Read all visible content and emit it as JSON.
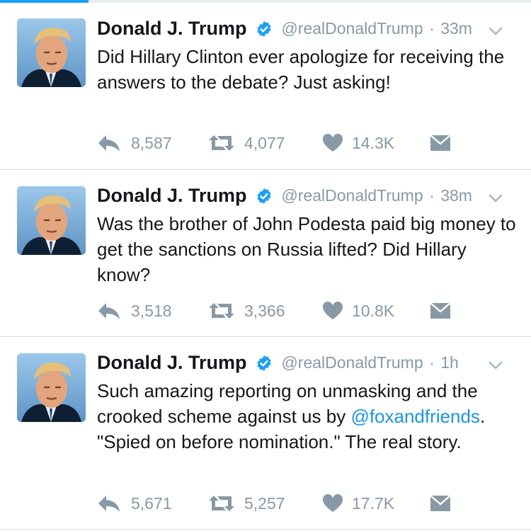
{
  "colors": {
    "accent": "#1da1f2",
    "muted": "#8899a6",
    "link": "#1b95e0",
    "verified": "#1da1f2"
  },
  "tweets": [
    {
      "name": "Donald J. Trump",
      "handle": "@realDonaldTrump",
      "separator": "·",
      "time": "33m",
      "text": "Did Hillary Clinton ever apologize for receiving the answers to the debate? Just asking!",
      "replies": "8,587",
      "retweets": "4,077",
      "likes": "14.3K"
    },
    {
      "name": "Donald J. Trump",
      "handle": "@realDonaldTrump",
      "separator": "·",
      "time": "38m",
      "text": "Was the brother of John Podesta paid big money to get the sanctions on Russia lifted? Did Hillary know?",
      "replies": "3,518",
      "retweets": "3,366",
      "likes": "10.8K"
    },
    {
      "name": "Donald J. Trump",
      "handle": "@realDonaldTrump",
      "separator": "·",
      "time": "1h",
      "text_before": "Such amazing reporting on unmasking and the crooked scheme against us by",
      "mention": "@foxandfriends",
      "text_after": ". \"Spied on before nomination.\" The real story.",
      "replies": "5,671",
      "retweets": "5,257",
      "likes": "17.7K"
    }
  ],
  "icons": [
    "verified-badge-icon",
    "chevron-down-icon",
    "reply-icon",
    "retweet-icon",
    "heart-icon",
    "direct-message-icon"
  ]
}
